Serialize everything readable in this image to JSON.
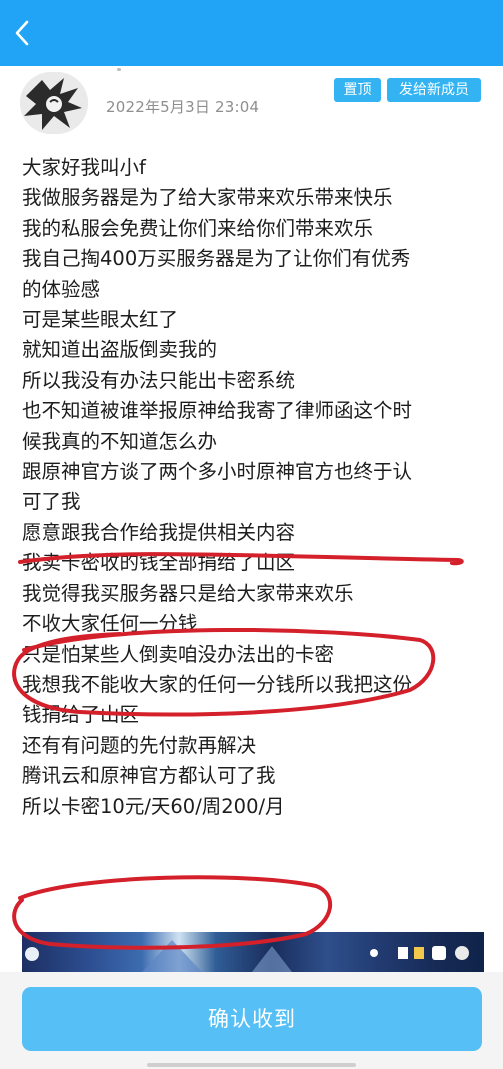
{
  "header": {
    "back_icon": "chevron-left-icon"
  },
  "post": {
    "date": "2022年5月3日 23:04",
    "tags": {
      "pin": "置顶",
      "send_to_new": "发给新成员"
    },
    "lines": [
      "大家好我叫小f",
      "我做服务器是为了给大家带来欢乐带来快乐",
      "我的私服会免费让你们来给你们带来欢乐",
      "我自己掏400万买服务器是为了让你们有优秀",
      "的体验感",
      "可是某些眼太红了",
      "就知道出盗版倒卖我的",
      "所以我没有办法只能出卡密系统",
      "也不知道被谁举报原神给我寄了律师函这个时",
      "候我真的不知道怎么办",
      "跟原神官方谈了两个多小时原神官方也终于认",
      "可了我",
      "愿意跟我合作给我提供相关内容",
      "我卖卡密收的钱全部捐给了山区",
      "我觉得我买服务器只是给大家带来欢乐",
      "不收大家任何一分钱",
      "只是怕某些人倒卖咱没办法出的卡密",
      "我想我不能收大家的任何一分钱所以我把这份",
      "钱捐给了山区",
      "还有有问题的先付款再解决",
      "腾讯云和原神官方都认可了我",
      "所以卡密10元/天60/周200/月"
    ]
  },
  "confirm_button": {
    "label": "确认收到"
  },
  "colors": {
    "header": "#21a4f5",
    "tag": "#33b3f2",
    "button": "#56bff6",
    "annotation": "#d4202a"
  }
}
